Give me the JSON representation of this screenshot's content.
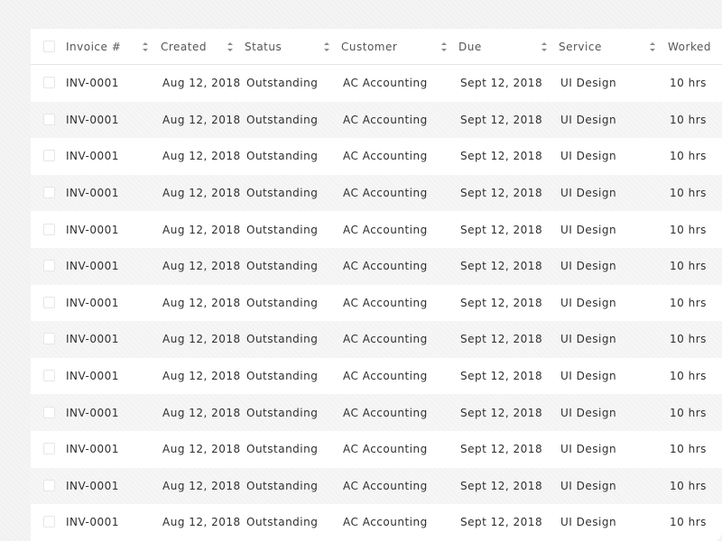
{
  "table": {
    "headers": {
      "invoice": "Invoice #",
      "created": "Created",
      "status": "Status",
      "customer": "Customer",
      "due": "Due",
      "service": "Service",
      "worked": "Worked"
    },
    "rows": [
      {
        "invoice": "INV-0001",
        "created": "Aug 12, 2018",
        "status": "Outstanding",
        "customer": "AC Accounting",
        "due": "Sept 12, 2018",
        "service": "UI Design",
        "worked": "10 hrs"
      },
      {
        "invoice": "INV-0001",
        "created": "Aug 12, 2018",
        "status": "Outstanding",
        "customer": "AC Accounting",
        "due": "Sept 12, 2018",
        "service": "UI Design",
        "worked": "10 hrs"
      },
      {
        "invoice": "INV-0001",
        "created": "Aug 12, 2018",
        "status": "Outstanding",
        "customer": "AC Accounting",
        "due": "Sept 12, 2018",
        "service": "UI Design",
        "worked": "10 hrs"
      },
      {
        "invoice": "INV-0001",
        "created": "Aug 12, 2018",
        "status": "Outstanding",
        "customer": "AC Accounting",
        "due": "Sept 12, 2018",
        "service": "UI Design",
        "worked": "10 hrs"
      },
      {
        "invoice": "INV-0001",
        "created": "Aug 12, 2018",
        "status": "Outstanding",
        "customer": "AC Accounting",
        "due": "Sept 12, 2018",
        "service": "UI Design",
        "worked": "10 hrs"
      },
      {
        "invoice": "INV-0001",
        "created": "Aug 12, 2018",
        "status": "Outstanding",
        "customer": "AC Accounting",
        "due": "Sept 12, 2018",
        "service": "UI Design",
        "worked": "10 hrs"
      },
      {
        "invoice": "INV-0001",
        "created": "Aug 12, 2018",
        "status": "Outstanding",
        "customer": "AC Accounting",
        "due": "Sept 12, 2018",
        "service": "UI Design",
        "worked": "10 hrs"
      },
      {
        "invoice": "INV-0001",
        "created": "Aug 12, 2018",
        "status": "Outstanding",
        "customer": "AC Accounting",
        "due": "Sept 12, 2018",
        "service": "UI Design",
        "worked": "10 hrs"
      },
      {
        "invoice": "INV-0001",
        "created": "Aug 12, 2018",
        "status": "Outstanding",
        "customer": "AC Accounting",
        "due": "Sept 12, 2018",
        "service": "UI Design",
        "worked": "10 hrs"
      },
      {
        "invoice": "INV-0001",
        "created": "Aug 12, 2018",
        "status": "Outstanding",
        "customer": "AC Accounting",
        "due": "Sept 12, 2018",
        "service": "UI Design",
        "worked": "10 hrs"
      },
      {
        "invoice": "INV-0001",
        "created": "Aug 12, 2018",
        "status": "Outstanding",
        "customer": "AC Accounting",
        "due": "Sept 12, 2018",
        "service": "UI Design",
        "worked": "10 hrs"
      },
      {
        "invoice": "INV-0001",
        "created": "Aug 12, 2018",
        "status": "Outstanding",
        "customer": "AC Accounting",
        "due": "Sept 12, 2018",
        "service": "UI Design",
        "worked": "10 hrs"
      },
      {
        "invoice": "INV-0001",
        "created": "Aug 12, 2018",
        "status": "Outstanding",
        "customer": "AC Accounting",
        "due": "Sept 12, 2018",
        "service": "UI Design",
        "worked": "10 hrs"
      }
    ]
  }
}
